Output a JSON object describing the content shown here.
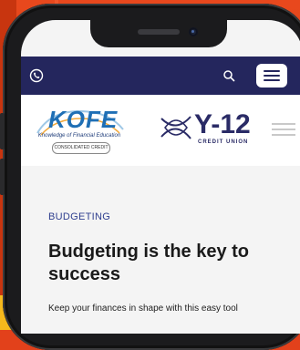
{
  "topbar": {
    "phone_icon": "phone-icon",
    "search_icon": "search-icon",
    "menu_icon": "menu-icon",
    "colors": {
      "bar": "#24265d",
      "icon": "#ffffff"
    }
  },
  "logos": {
    "kofe": {
      "wordmark": "KOFE",
      "tagline": "Knowledge of Financial Education",
      "partner": "CONSOLIDATED CREDIT"
    },
    "y12": {
      "wordmark": "Y-12",
      "subtitle": "CREDIT UNION"
    }
  },
  "article": {
    "category": "BUDGETING",
    "title": "Budgeting is the key to success",
    "description": "Keep your finances in shape with this easy tool"
  },
  "colors": {
    "background": "#e2411b",
    "accent": "#2f3f8f",
    "kofe_blue": "#1f6fb5",
    "y12_navy": "#2a2b66"
  }
}
